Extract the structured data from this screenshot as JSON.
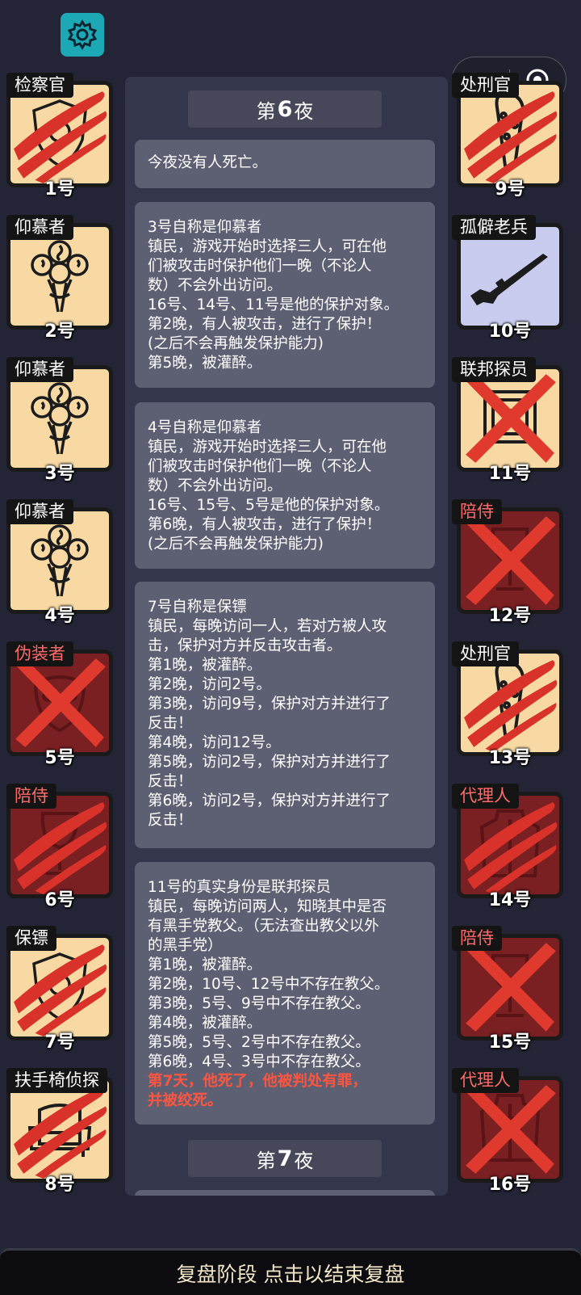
{
  "header": {
    "settings_icon": "gear-icon",
    "menu_icon": "more-dots-icon",
    "close_icon": "target-circle-icon"
  },
  "left_players": [
    {
      "role": "检察官",
      "num": "1号",
      "bg": "tan",
      "icon": "shield-icon",
      "mark": "claw"
    },
    {
      "role": "仰慕者",
      "num": "2号",
      "bg": "tan",
      "icon": "rose-bouquet-icon",
      "mark": "none"
    },
    {
      "role": "仰慕者",
      "num": "3号",
      "bg": "tan",
      "icon": "rose-bouquet-icon",
      "mark": "none"
    },
    {
      "role": "仰慕者",
      "num": "4号",
      "bg": "tan",
      "icon": "rose-bouquet-icon",
      "mark": "none"
    },
    {
      "role": "伪装者",
      "num": "5号",
      "bg": "red",
      "icon": "mask-icon",
      "mark": "cross",
      "role_red": true
    },
    {
      "role": "陪侍",
      "num": "6号",
      "bg": "red",
      "icon": "wine-glass-icon",
      "mark": "claw",
      "role_red": true
    },
    {
      "role": "保镖",
      "num": "7号",
      "bg": "tan",
      "icon": "shield-icon",
      "mark": "claw"
    },
    {
      "role": "扶手椅侦探",
      "num": "8号",
      "bg": "tan",
      "icon": "armchair-icon",
      "mark": "claw"
    }
  ],
  "right_players": [
    {
      "role": "处刑官",
      "num": "9号",
      "bg": "tan",
      "icon": "club-icon",
      "mark": "claw"
    },
    {
      "role": "孤僻老兵",
      "num": "10号",
      "bg": "lav",
      "icon": "rifle-icon",
      "mark": "none"
    },
    {
      "role": "联邦探员",
      "num": "11号",
      "bg": "tan",
      "icon": "badge-icon",
      "mark": "cross"
    },
    {
      "role": "陪侍",
      "num": "12号",
      "bg": "red",
      "icon": "wine-glass-icon",
      "mark": "cross",
      "role_red": true
    },
    {
      "role": "处刑官",
      "num": "13号",
      "bg": "tan",
      "icon": "club-icon",
      "mark": "claw"
    },
    {
      "role": "代理人",
      "num": "14号",
      "bg": "red",
      "icon": "coat-icon",
      "mark": "claw",
      "role_red": true
    },
    {
      "role": "陪侍",
      "num": "15号",
      "bg": "red",
      "icon": "wine-glass-icon",
      "mark": "cross",
      "role_red": true
    },
    {
      "role": "代理人",
      "num": "16号",
      "bg": "red",
      "icon": "coat-icon",
      "mark": "cross",
      "role_red": true
    }
  ],
  "log": {
    "night6": {
      "prefix": "第",
      "n": "6",
      "suffix": "夜"
    },
    "night7": {
      "prefix": "第",
      "n": "7",
      "suffix": "夜"
    },
    "msg1": [
      "今夜没有人死亡。"
    ],
    "msg2": [
      "3号自称是仰慕者",
      "镇民，游戏开始时选择三人，可在他",
      "们被攻击时保护他们一晚（不论人",
      "数）不会外出访问。",
      "16号、14号、11号是他的保护对象。",
      "第2晚，有人被攻击，进行了保护！",
      "(之后不会再触发保护能力)",
      "第5晚，被灌醉。"
    ],
    "msg3": [
      "4号自称是仰慕者",
      "镇民，游戏开始时选择三人，可在他",
      "们被攻击时保护他们一晚（不论人",
      "数）不会外出访问。",
      "16号、15号、5号是他的保护对象。",
      "第6晚，有人被攻击，进行了保护！",
      "(之后不会再触发保护能力)"
    ],
    "msg4": [
      "7号自称是保镖",
      "镇民，每晚访问一人，若对方被人攻",
      "击，保护对方并反击攻击者。",
      "第1晚，被灌醉。",
      "第2晚，访问2号。",
      "第3晚，访问9号，保护对方并进行了",
      "反击！",
      "第4晚，访问12号。",
      "第5晚，访问2号，保护对方并进行了",
      "反击！",
      "第6晚，访问2号，保护对方并进行了",
      "反击！"
    ],
    "msg5": [
      "11号的真实身份是联邦探员",
      "镇民，每晚访问两人，知晓其中是否",
      "有黑手党教父。（无法查出教父以外",
      "的黑手党）",
      "第1晚，被灌醉。",
      "第2晚，10号、12号中不存在教父。",
      "第3晚，5号、9号中不存在教父。",
      "第4晚，被灌醉。",
      "第5晚，5号、2号中不存在教父。",
      "第6晚，4号、3号中不存在教父。"
    ],
    "msg5_alert": [
      "第7天，他死了，他被判处有罪，",
      "并被绞死。"
    ]
  },
  "bottom_bar": {
    "label": "复盘阶段 点击以结束复盘"
  },
  "colors": {
    "bg": "#232536",
    "panel": "#34364b",
    "message": "#5d6073",
    "alert": "#ff5540",
    "tan": "#f8d9a3",
    "red_card": "#7a1f22",
    "lavender": "#c9cbef",
    "claw": "#d8322a",
    "settings": "#1ca9b5"
  }
}
